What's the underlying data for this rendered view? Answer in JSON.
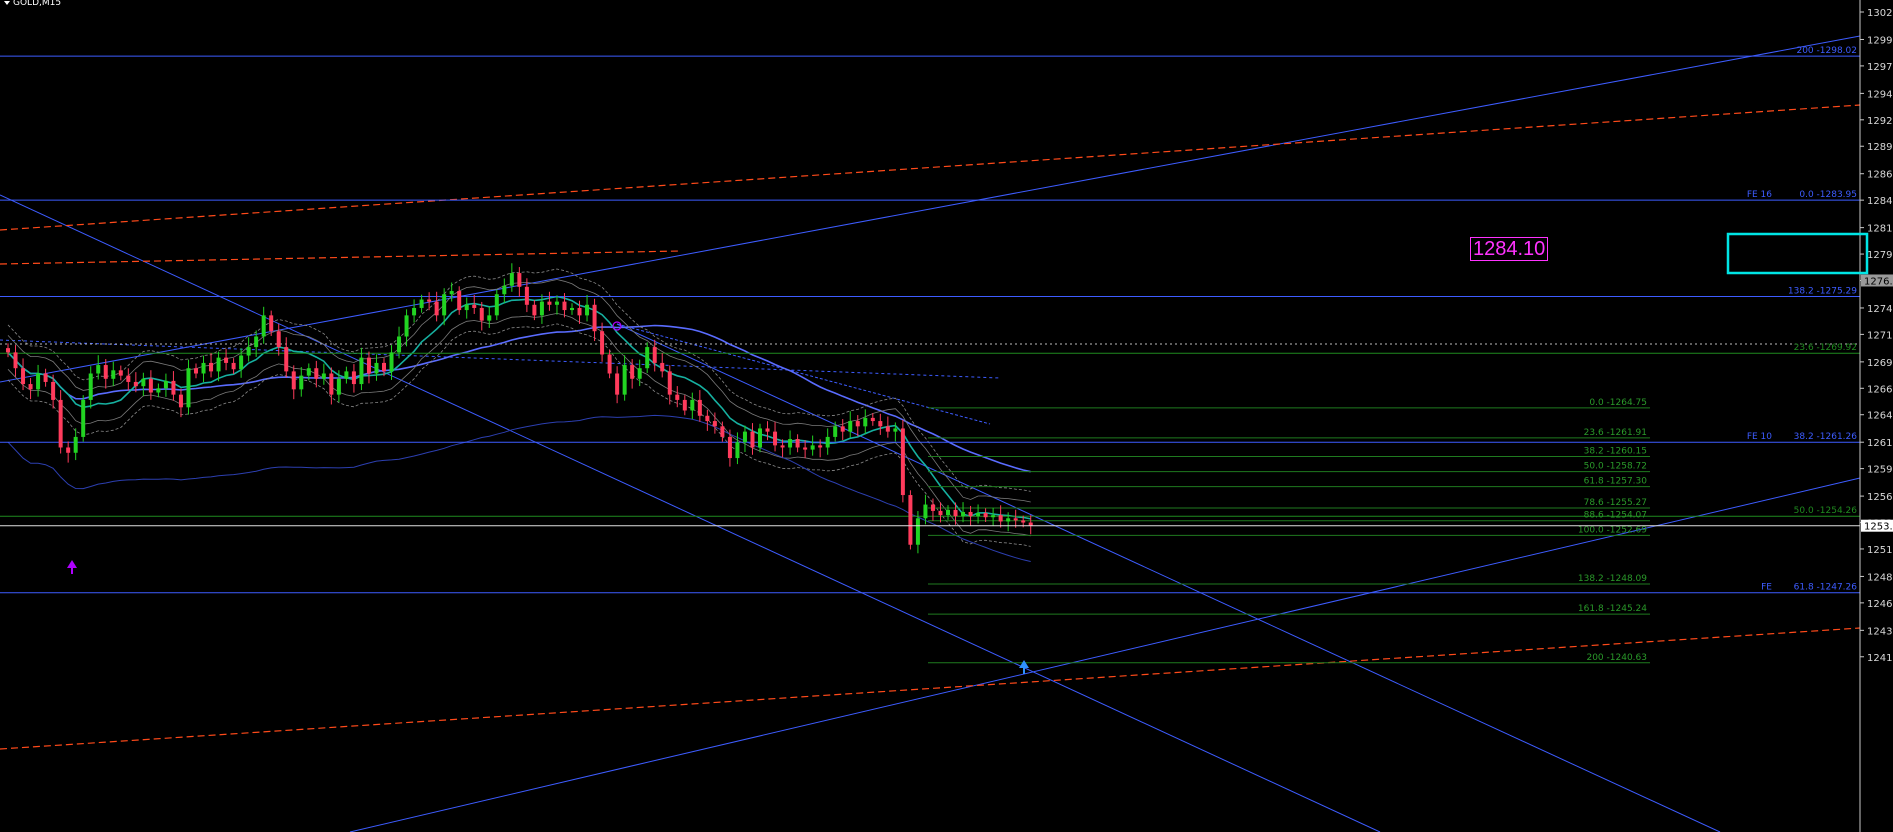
{
  "window": {
    "symbol": "GOLD,M15"
  },
  "price_callout": "1284.10",
  "chart_data": {
    "type": "candlestick",
    "symbol": "GOLD",
    "timeframe": "M15",
    "y_axis": {
      "ticks": [
        "1302.2",
        "1299.6",
        "1297.1",
        "1294.5",
        "1292.0",
        "1289.5",
        "1286.9",
        "1284.4",
        "1281.8",
        "1279.3",
        "1276.8",
        "1274.2",
        "1271.7",
        "1269.1",
        "1266.6",
        "1264.1",
        "1261.5",
        "1259.0",
        "1256.4",
        "1253.9",
        "1251.4",
        "1248.8",
        "1246.3",
        "1243.7",
        "1241.2"
      ],
      "current_price_label": "1253.6",
      "marker_label": "1276.8",
      "range": [
        1239.5,
        1303.4
      ]
    },
    "horizontal_levels": [
      {
        "label": "200 -1298.02",
        "price": 1298.02,
        "color": "#3d5cff"
      },
      {
        "label": "0.0 -1283.95",
        "prefix": "FE 16",
        "price": 1284.4,
        "color": "#3d5cff"
      },
      {
        "label": "138.2 -1275.29",
        "price": 1275.29,
        "color": "#3d5cff"
      },
      {
        "label": "38.2 -1261.26",
        "prefix": "FE 10",
        "price": 1261.5,
        "color": "#3d5cff"
      },
      {
        "label": "61.8 -1247.26",
        "prefix": "FE",
        "price": 1247.26,
        "color": "#3d5cff"
      },
      {
        "label": "23.6 -1269.92",
        "price": 1269.92,
        "color": "#1f8a1f"
      },
      {
        "label": "50.0 -1254.26",
        "price": 1254.5,
        "color": "#1f8a1f"
      }
    ],
    "fib_levels": [
      {
        "label": "0.0 -1264.75",
        "price": 1264.75
      },
      {
        "label": "23.6 -1261.91",
        "price": 1261.91
      },
      {
        "label": "38.2 -1260.15",
        "price": 1260.15
      },
      {
        "label": "50.0 -1258.72",
        "price": 1258.72
      },
      {
        "label": "61.8 -1257.30",
        "price": 1257.3
      },
      {
        "label": "78.6 -1255.27",
        "price": 1255.27
      },
      {
        "label": "88.6 -1254.07",
        "price": 1254.07
      },
      {
        "label": "100.0 -1252.69",
        "price": 1252.69
      },
      {
        "label": "138.2 -1248.09",
        "price": 1248.09
      },
      {
        "label": "161.8 -1245.24",
        "price": 1245.24
      },
      {
        "label": "200 -1240.63",
        "price": 1240.63
      }
    ],
    "candles_close": [
      1270.0,
      1268.5,
      1267.0,
      1266.5,
      1268.0,
      1267.2,
      1265.5,
      1261.0,
      1260.5,
      1262.0,
      1265.5,
      1268.0,
      1268.8,
      1267.5,
      1268.3,
      1267.8,
      1267.2,
      1266.8,
      1267.5,
      1266.2,
      1266.6,
      1267.3,
      1266.0,
      1264.8,
      1268.5,
      1268.0,
      1269.0,
      1268.2,
      1269.5,
      1269.0,
      1268.4,
      1269.7,
      1270.5,
      1271.5,
      1273.5,
      1272.0,
      1270.5,
      1268.2,
      1266.5,
      1267.8,
      1268.5,
      1267.5,
      1268.0,
      1266.0,
      1267.5,
      1268.2,
      1267.0,
      1269.5,
      1268.0,
      1269.0,
      1268.2,
      1270.0,
      1271.5,
      1273.5,
      1274.2,
      1275.0,
      1274.8,
      1273.5,
      1275.5,
      1275.8,
      1274.0,
      1274.5,
      1274.2,
      1273.0,
      1273.5,
      1275.5,
      1276.3,
      1277.5,
      1276.2,
      1274.5,
      1273.5,
      1274.8,
      1274.5,
      1274.8,
      1274.0,
      1274.2,
      1273.5,
      1274.5,
      1272.0,
      1269.8,
      1268.0,
      1266.0,
      1268.8,
      1267.5,
      1268.5,
      1270.5,
      1269.0,
      1268.2,
      1266.0,
      1265.5,
      1264.5,
      1265.5,
      1264.0,
      1263.5,
      1263.0,
      1262.0,
      1260.0,
      1261.5,
      1262.5,
      1261.0,
      1262.8,
      1262.5,
      1261.2,
      1261.0,
      1261.8,
      1261.0,
      1260.8,
      1261.2,
      1261.0,
      1262.0,
      1263.0,
      1262.5,
      1263.5,
      1263.0,
      1263.8,
      1263.5,
      1263.0,
      1262.5,
      1262.8,
      1256.5,
      1251.8,
      1254.3,
      1255.6,
      1255.0,
      1254.6,
      1255.1,
      1254.5,
      1254.9,
      1254.5,
      1254.8,
      1254.4,
      1254.6,
      1254.0,
      1254.3,
      1254.1,
      1253.9,
      1253.6
    ],
    "annotations": [
      "1284.10"
    ]
  }
}
